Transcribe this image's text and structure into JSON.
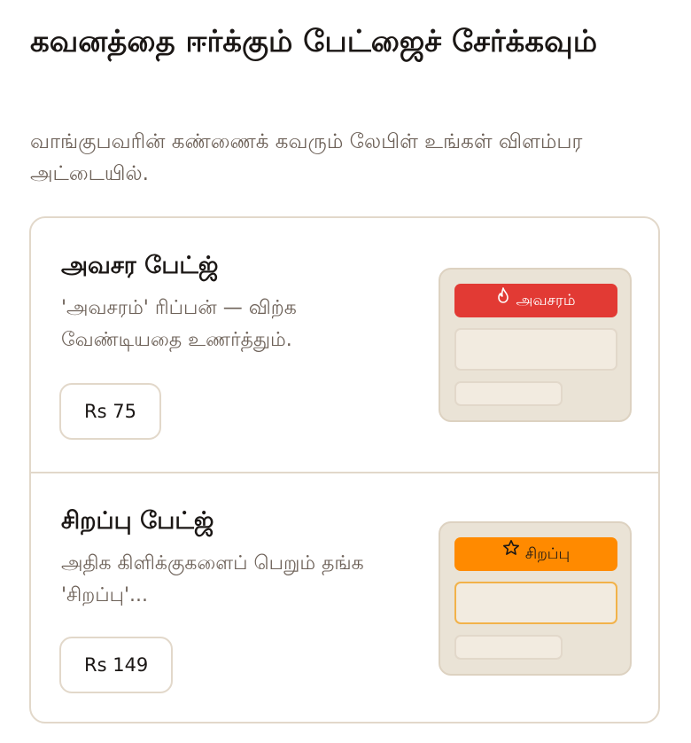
{
  "header": {
    "title": "கவனத்தை ஈர்க்கும் பேட்ஜைச் சேர்க்கவும்",
    "subtitle": "வாங்குபவரின் கண்ணைக் கவரும் லேபிள் உங்கள் விளம்பர அட்டையில்."
  },
  "offers": [
    {
      "name": "அவசர பேட்ஜ்",
      "description": "'அவசரம்' ரிப்பன் — விற்க வேண்டியதை உணர்த்தும்.",
      "price": "Rs 75",
      "preview": {
        "ribbon_label": "அவசரம்",
        "ribbon_icon": "flame-icon",
        "ribbon_color": "#e23a34"
      }
    },
    {
      "name": "சிறப்பு பேட்ஜ்",
      "description": "அதிக கிளிக்குகளைப் பெறும் தங்க 'சிறப்பு'...",
      "price": "Rs 149",
      "preview": {
        "ribbon_label": "சிறப்பு",
        "ribbon_icon": "star-icon",
        "ribbon_color": "#ff8a00"
      }
    }
  ],
  "colors": {
    "border": "#e2d8ca",
    "preview_bg": "#eae3d6",
    "muted_text": "#6e6259"
  }
}
